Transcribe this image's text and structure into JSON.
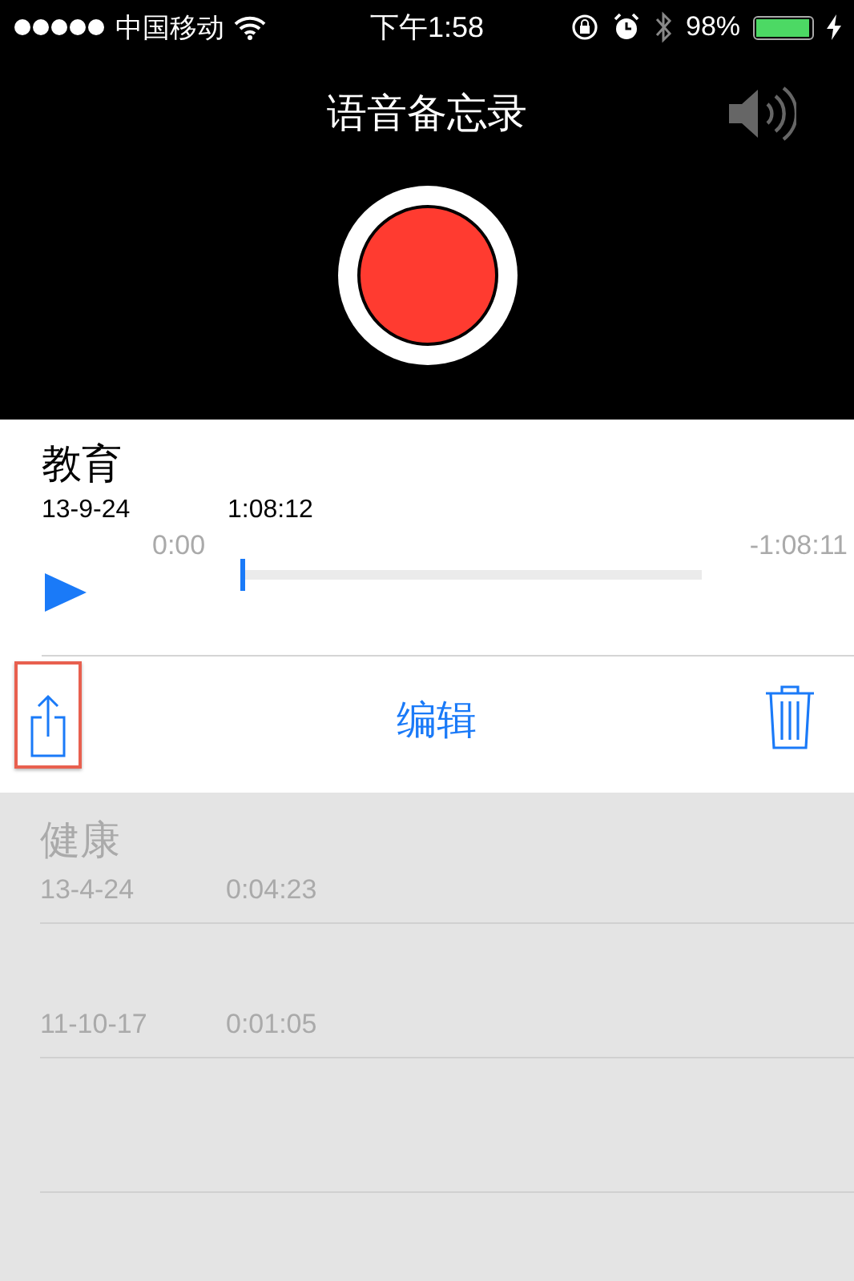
{
  "status_bar": {
    "carrier": "中国移动",
    "time": "下午1:58",
    "battery_percent": "98%",
    "battery": {
      "level": 0.98,
      "charging": true
    }
  },
  "header": {
    "title": "语音备忘录"
  },
  "current_memo": {
    "title": "教育",
    "date": "13-9-24",
    "duration": "1:08:12",
    "elapsed": "0:00",
    "remaining": "-1:08:11",
    "playback": {
      "level": 0
    },
    "edit_label": "编辑",
    "share_highlighted": true
  },
  "memos": [
    {
      "title": "健康",
      "date": "13-4-24",
      "duration": "0:04:23"
    },
    {
      "date": "11-10-17",
      "duration": "0:01:05"
    }
  ]
}
